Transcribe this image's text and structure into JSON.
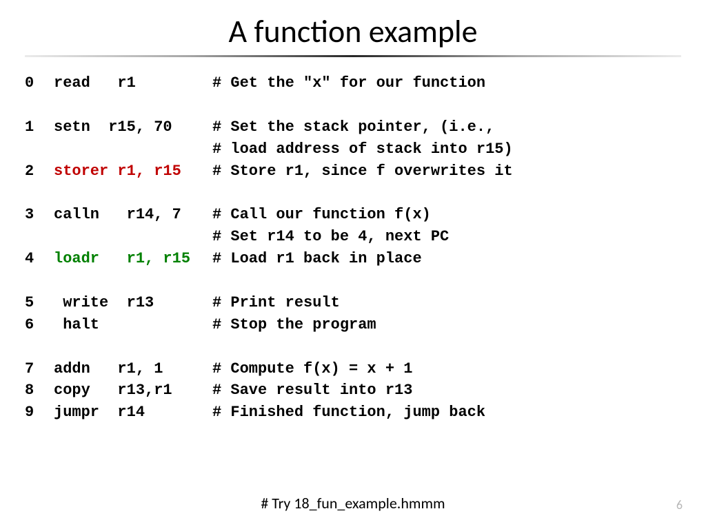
{
  "title": "A function example",
  "lines": [
    {
      "num": "0",
      "instr": "read   r1",
      "cls": "",
      "comment": "# Get the \"x\" for our function"
    },
    {
      "blank": true
    },
    {
      "num": "1",
      "instr": "setn  r15, 70",
      "cls": "",
      "comment": "# Set the stack pointer, (i.e.,"
    },
    {
      "num": "",
      "instr": "",
      "cls": "",
      "comment": "# load address of stack into r15)"
    },
    {
      "num": "2",
      "instr": "storer r1, r15",
      "cls": "red",
      "comment": "# Store r1, since f overwrites it"
    },
    {
      "blank": true
    },
    {
      "num": "3",
      "instr": "calln   r14, 7",
      "cls": "",
      "comment": "# Call our function f(x)"
    },
    {
      "num": "",
      "instr": "",
      "cls": "",
      "comment": "# Set r14 to be 4, next PC"
    },
    {
      "num": "4",
      "instr": "loadr   r1, r15",
      "cls": "green",
      "comment": "# Load r1 back in place"
    },
    {
      "blank": true
    },
    {
      "num": "5",
      "instr": " write  r13",
      "cls": "",
      "comment": "# Print result"
    },
    {
      "num": "6",
      "instr": " halt",
      "cls": "",
      "comment": "# Stop the program"
    },
    {
      "blank": true
    },
    {
      "num": "7",
      "instr": "addn   r1, 1",
      "cls": "",
      "comment": "# Compute f(x) = x + 1"
    },
    {
      "num": "8",
      "instr": "copy   r13,r1",
      "cls": "",
      "comment": "# Save result into r13"
    },
    {
      "num": "9",
      "instr": "jumpr  r14",
      "cls": "",
      "comment": "# Finished function, jump back"
    }
  ],
  "footnote": "# Try 18_fun_example.hmmm",
  "page": "6"
}
